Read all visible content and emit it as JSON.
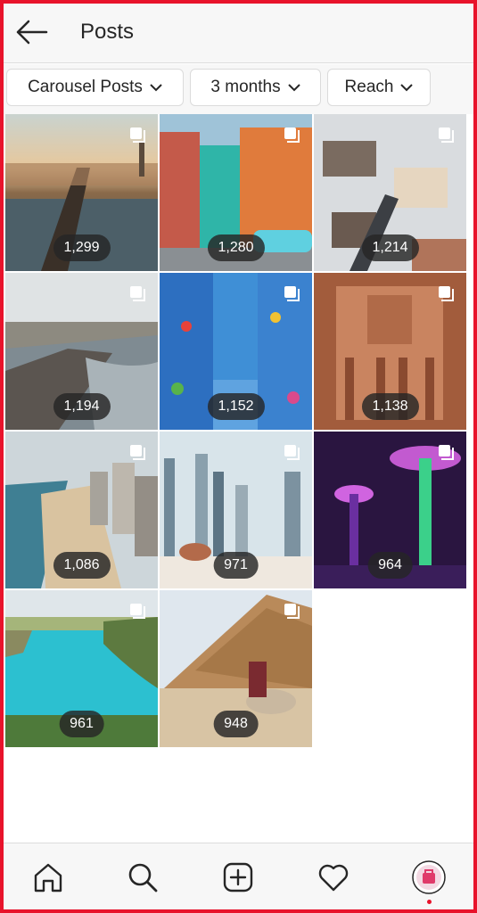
{
  "header": {
    "title": "Posts",
    "back_icon": "arrow-left-icon"
  },
  "filters": [
    {
      "label": "Carousel Posts"
    },
    {
      "label": "3 months"
    },
    {
      "label": "Reach"
    }
  ],
  "posts": [
    {
      "reach": "1,299",
      "subject": "prague-bridge"
    },
    {
      "reach": "1,280",
      "subject": "havana-street"
    },
    {
      "reach": "1,214",
      "subject": "snowy-rooftops"
    },
    {
      "reach": "1,194",
      "subject": "coastal-city"
    },
    {
      "reach": "1,152",
      "subject": "blue-alley"
    },
    {
      "reach": "1,138",
      "subject": "petra-treasury"
    },
    {
      "reach": "1,086",
      "subject": "beach-skyline"
    },
    {
      "reach": "971",
      "subject": "dubai-camel"
    },
    {
      "reach": "964",
      "subject": "supertree-grove"
    },
    {
      "reach": "961",
      "subject": "turquoise-cove"
    },
    {
      "reach": "948",
      "subject": "pyramid-camel"
    }
  ],
  "bottom_nav": [
    {
      "icon": "home-icon"
    },
    {
      "icon": "search-icon"
    },
    {
      "icon": "add-post-icon"
    },
    {
      "icon": "heart-icon"
    },
    {
      "icon": "profile-avatar"
    }
  ],
  "colors": {
    "frame": "#e8132b",
    "badge_bg": "#262626",
    "accent": "#e8132b"
  }
}
